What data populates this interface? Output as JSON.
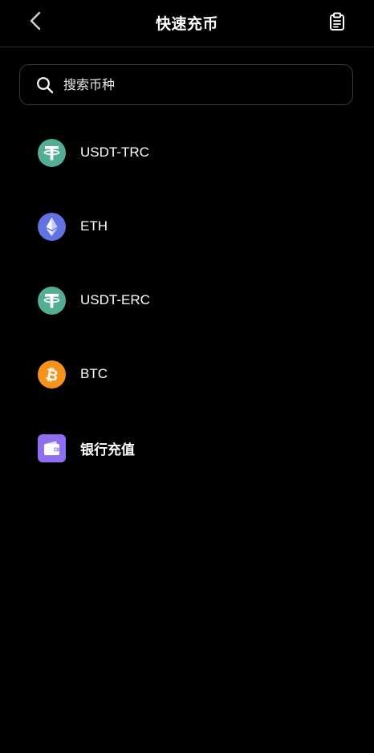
{
  "header": {
    "title": "快速充币"
  },
  "search": {
    "placeholder": "搜索币种"
  },
  "coins": [
    {
      "label": "USDT-TRC",
      "icon": "tether-icon",
      "color": "#53ae94"
    },
    {
      "label": "ETH",
      "icon": "ethereum-icon",
      "color": "#6272e0"
    },
    {
      "label": "USDT-ERC",
      "icon": "tether-icon",
      "color": "#53ae94"
    },
    {
      "label": "BTC",
      "icon": "bitcoin-icon",
      "color": "#f7931a"
    },
    {
      "label": "银行充值",
      "icon": "wallet-icon",
      "color": "#8f6ef2"
    }
  ]
}
